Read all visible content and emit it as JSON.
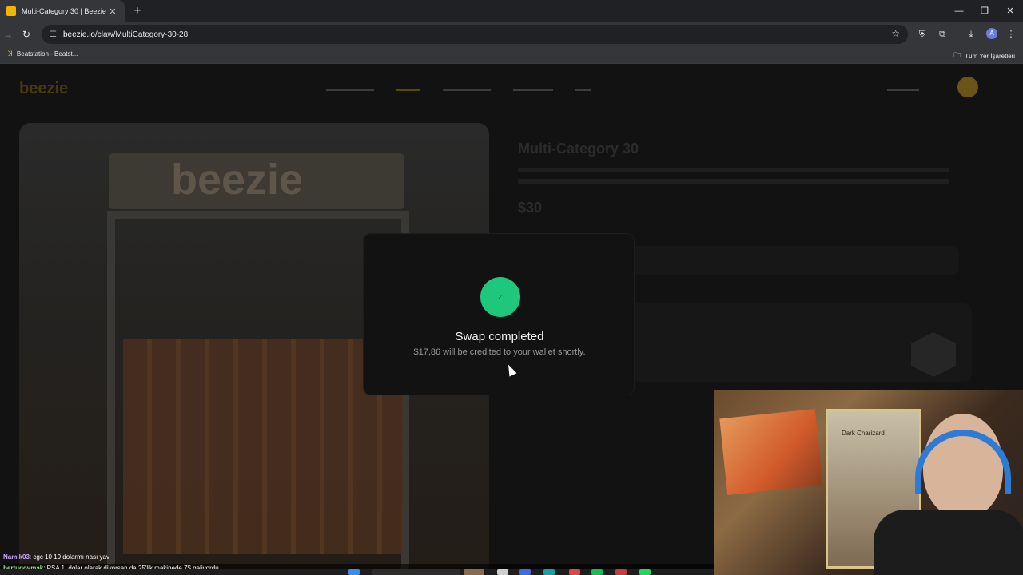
{
  "browser": {
    "tab_title": "Multi-Category 30 | Beezie",
    "new_tab": "+",
    "url_host": "beezie.io",
    "url_path": "/claw/MultiCategory-30-28",
    "bookmark_left": "Beatstation - Beatst...",
    "bookmark_right": "Tüm Yer İşaretleri",
    "profile_initial": "A"
  },
  "site": {
    "logo": "beezie",
    "product_title": "Multi-Category 30",
    "product_price": "$30"
  },
  "claw_brand": "beezie",
  "modal": {
    "title": "Swap completed",
    "message": "$17,86 will be credited to your wallet shortly."
  },
  "webcam": {
    "card_label": "Dark Charizard"
  },
  "chat": [
    {
      "user": "Namik03",
      "text": ": cgc 10 19 dolarmı nası yav"
    },
    {
      "user": "bertugoymak",
      "text": ": PSA 1, dolar olarak diyorsan da 25'lik makinede 7$ geliyordu"
    }
  ],
  "colors": {
    "accent": "#f5b400",
    "success": "#1fc77d"
  }
}
